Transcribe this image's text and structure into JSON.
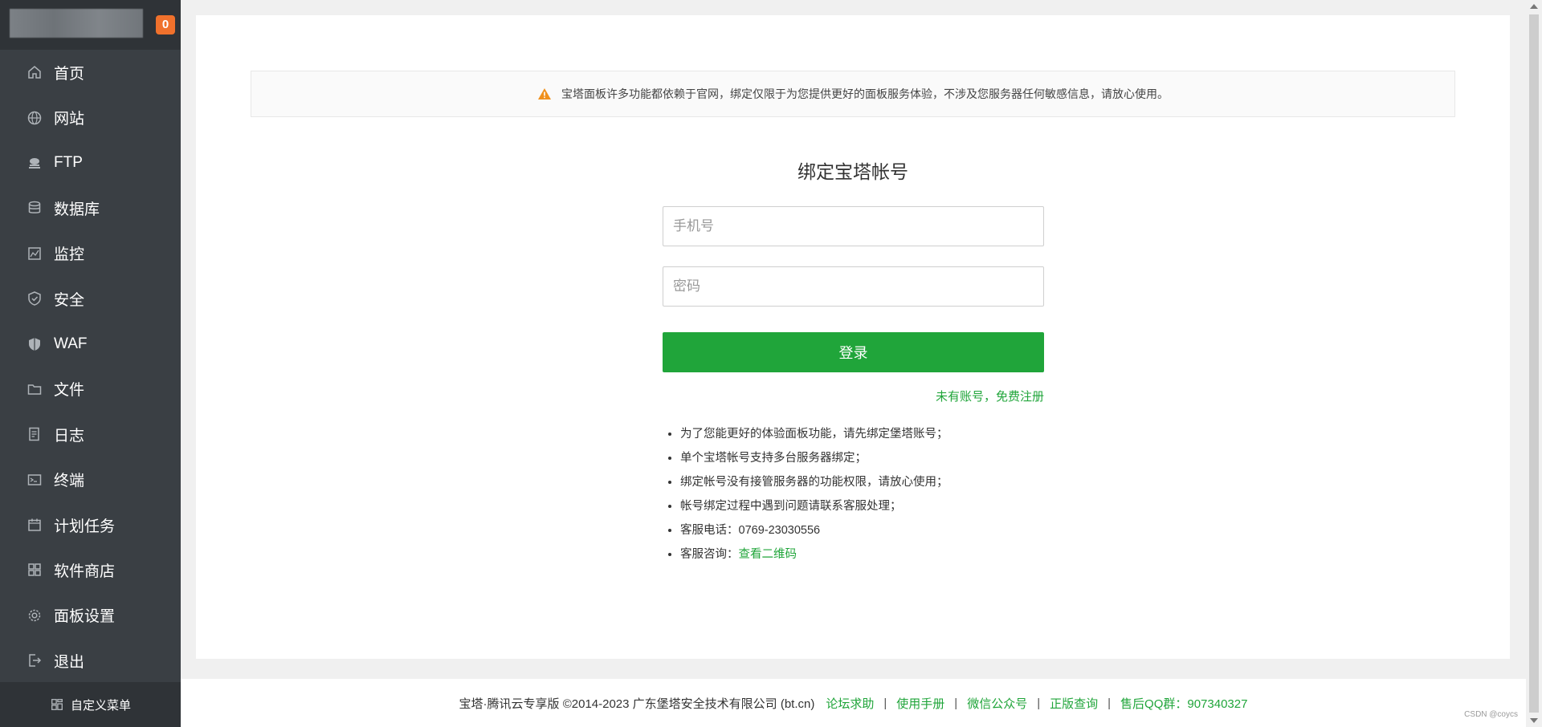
{
  "sidebar": {
    "server_name": "",
    "badge_count": "0",
    "items": [
      {
        "label": "首页",
        "icon": "home-icon"
      },
      {
        "label": "网站",
        "icon": "globe-icon"
      },
      {
        "label": "FTP",
        "icon": "ftp-icon"
      },
      {
        "label": "数据库",
        "icon": "database-icon"
      },
      {
        "label": "监控",
        "icon": "monitor-icon"
      },
      {
        "label": "安全",
        "icon": "shield-icon"
      },
      {
        "label": "WAF",
        "icon": "waf-shield-icon"
      },
      {
        "label": "文件",
        "icon": "folder-icon"
      },
      {
        "label": "日志",
        "icon": "log-icon"
      },
      {
        "label": "终端",
        "icon": "terminal-icon"
      },
      {
        "label": "计划任务",
        "icon": "calendar-icon"
      },
      {
        "label": "软件商店",
        "icon": "grid-icon"
      },
      {
        "label": "面板设置",
        "icon": "gear-icon"
      },
      {
        "label": "退出",
        "icon": "logout-icon"
      }
    ],
    "custom_menu_label": "自定义菜单"
  },
  "notice": {
    "text": "宝塔面板许多功能都依赖于官网，绑定仅限于为您提供更好的面板服务体验，不涉及您服务器任何敏感信息，请放心使用。",
    "icon": "warning-icon",
    "icon_color": "#f0901c"
  },
  "form": {
    "title": "绑定宝塔帐号",
    "phone_placeholder": "手机号",
    "password_placeholder": "密码",
    "login_label": "登录",
    "register_link": "未有账号，免费注册"
  },
  "tips": [
    "为了您能更好的体验面板功能，请先绑定堡塔账号；",
    "单个宝塔帐号支持多台服务器绑定；",
    "绑定帐号没有接管服务器的功能权限，请放心使用；",
    "帐号绑定过程中遇到问题请联系客服处理；",
    "客服电话：0769-23030556"
  ],
  "consult": {
    "label": "客服咨询：",
    "link": "查看二维码"
  },
  "footer": {
    "copyright": "宝塔·腾讯云专享版 ©2014-2023 广东堡塔安全技术有限公司 (bt.cn)",
    "links": [
      "论坛求助",
      "使用手册",
      "微信公众号",
      "正版查询",
      "售后QQ群：907340327"
    ],
    "separator": "|"
  },
  "watermark": "CSDN @coycs",
  "colors": {
    "accent": "#20a53a",
    "sidebar_bg": "#3a3f44",
    "badge": "#f0712c"
  }
}
